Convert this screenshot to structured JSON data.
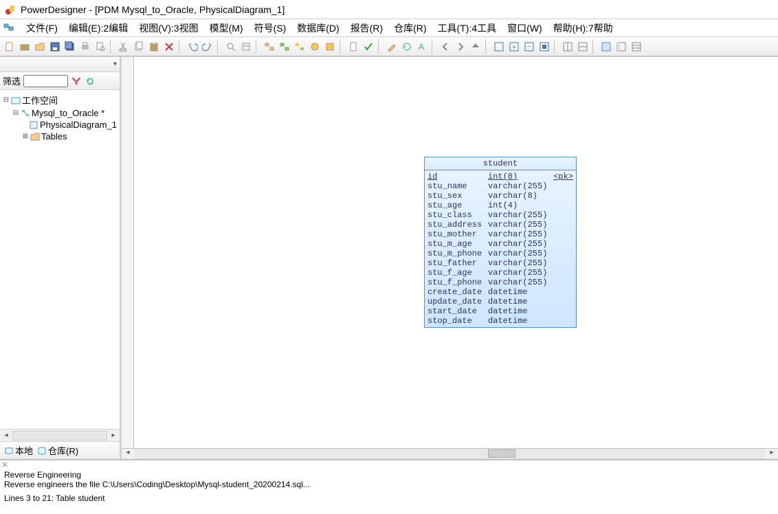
{
  "title": "PowerDesigner - [PDM Mysql_to_Oracle, PhysicalDiagram_1]",
  "menu": {
    "file": "文件(F)",
    "edit": "编辑(E):2编辑",
    "view": "视图(V):3视图",
    "model": "模型(M)",
    "symbol": "符号(S)",
    "database": "数据库(D)",
    "report": "报告(R)",
    "repository": "仓库(R)",
    "tools": "工具(T):4工具",
    "window": "窗口(W)",
    "help": "帮助(H):7帮助"
  },
  "left": {
    "filter_label": "筛选",
    "filter_value": "",
    "tree": {
      "root": "工作空间",
      "model": "Mysql_to_Oracle *",
      "diagram": "PhysicalDiagram_1",
      "tables_folder": "Tables"
    },
    "tabs": {
      "local": "本地",
      "repo": "仓库(R)"
    }
  },
  "entity": {
    "title": "student",
    "pk_tag": "<pk>",
    "columns": [
      {
        "name": "id",
        "type": "int(8)",
        "pk": true
      },
      {
        "name": "stu_name",
        "type": "varchar(255)",
        "pk": false
      },
      {
        "name": "stu_sex",
        "type": "varchar(8)",
        "pk": false
      },
      {
        "name": "stu_age",
        "type": "int(4)",
        "pk": false
      },
      {
        "name": "stu_class",
        "type": "varchar(255)",
        "pk": false
      },
      {
        "name": "stu_address",
        "type": "varchar(255)",
        "pk": false
      },
      {
        "name": "stu_mother",
        "type": "varchar(255)",
        "pk": false
      },
      {
        "name": "stu_m_age",
        "type": "varchar(255)",
        "pk": false
      },
      {
        "name": "stu_m_phone",
        "type": "varchar(255)",
        "pk": false
      },
      {
        "name": "stu_father",
        "type": "varchar(255)",
        "pk": false
      },
      {
        "name": "stu_f_age",
        "type": "varchar(255)",
        "pk": false
      },
      {
        "name": "stu_f_phone",
        "type": "varchar(255)",
        "pk": false
      },
      {
        "name": "create_date",
        "type": "datetime",
        "pk": false
      },
      {
        "name": "update_date",
        "type": "datetime",
        "pk": false
      },
      {
        "name": "start_date",
        "type": "datetime",
        "pk": false
      },
      {
        "name": "stop_date",
        "type": "datetime",
        "pk": false
      }
    ]
  },
  "log": {
    "heading": "Reverse Engineering",
    "line1": "Reverse engineers the file C:\\Users\\Coding\\Desktop\\Mysql-student_20200214.sql...",
    "line2": "Lines   3 to   21:  Table student"
  },
  "colors": {
    "accent": "#5a8fc9"
  }
}
